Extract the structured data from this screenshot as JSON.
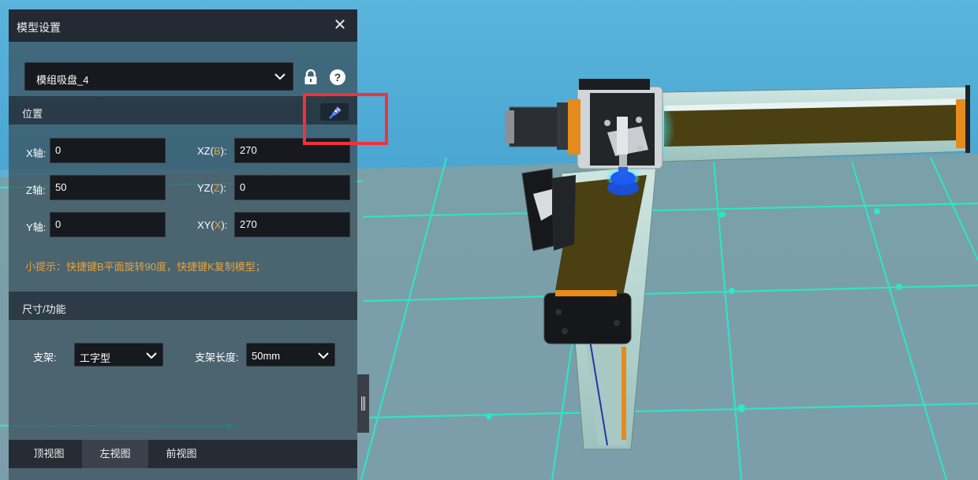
{
  "panel": {
    "title": "模型设置",
    "close_icon": "close-icon",
    "model_select": {
      "value": "模组吸盘_4"
    },
    "lock_icon": "lock-icon",
    "help_icon": "help-icon"
  },
  "position": {
    "section_label": "位置",
    "pick_icon": "pick-position-icon",
    "x_label": "X轴:",
    "x_value": "0",
    "z_label": "Z轴:",
    "z_value": "50",
    "y_label": "Y轴:",
    "y_value": "0",
    "xz_prefix": "XZ(",
    "xz_key": "B",
    "xz_suffix": "):",
    "xz_value": "270",
    "yz_prefix": "YZ(",
    "yz_key": "Z",
    "yz_suffix": "):",
    "yz_value": "0",
    "xy_prefix": "XY(",
    "xy_key": "X",
    "xy_suffix": "):",
    "xy_value": "270",
    "tip": "小提示：快捷键B平面旋转90度，快捷键K复制模型；"
  },
  "size": {
    "section_label": "尺寸/功能",
    "bracket_label": "支架:",
    "bracket_value": "工字型",
    "length_label": "支架长度:",
    "length_value": "50mm"
  },
  "view_tabs": [
    {
      "label": "顶视图"
    },
    {
      "label": "左视图"
    },
    {
      "label": "前视图"
    }
  ],
  "active_tab": "左视图",
  "colors": {
    "accent_orange": "#e8a23a",
    "highlight_red": "#f0323d",
    "panel_dark": "#21262e",
    "grid_cyan": "#2ee6c8",
    "sky_blue": "#5fb0d6"
  }
}
